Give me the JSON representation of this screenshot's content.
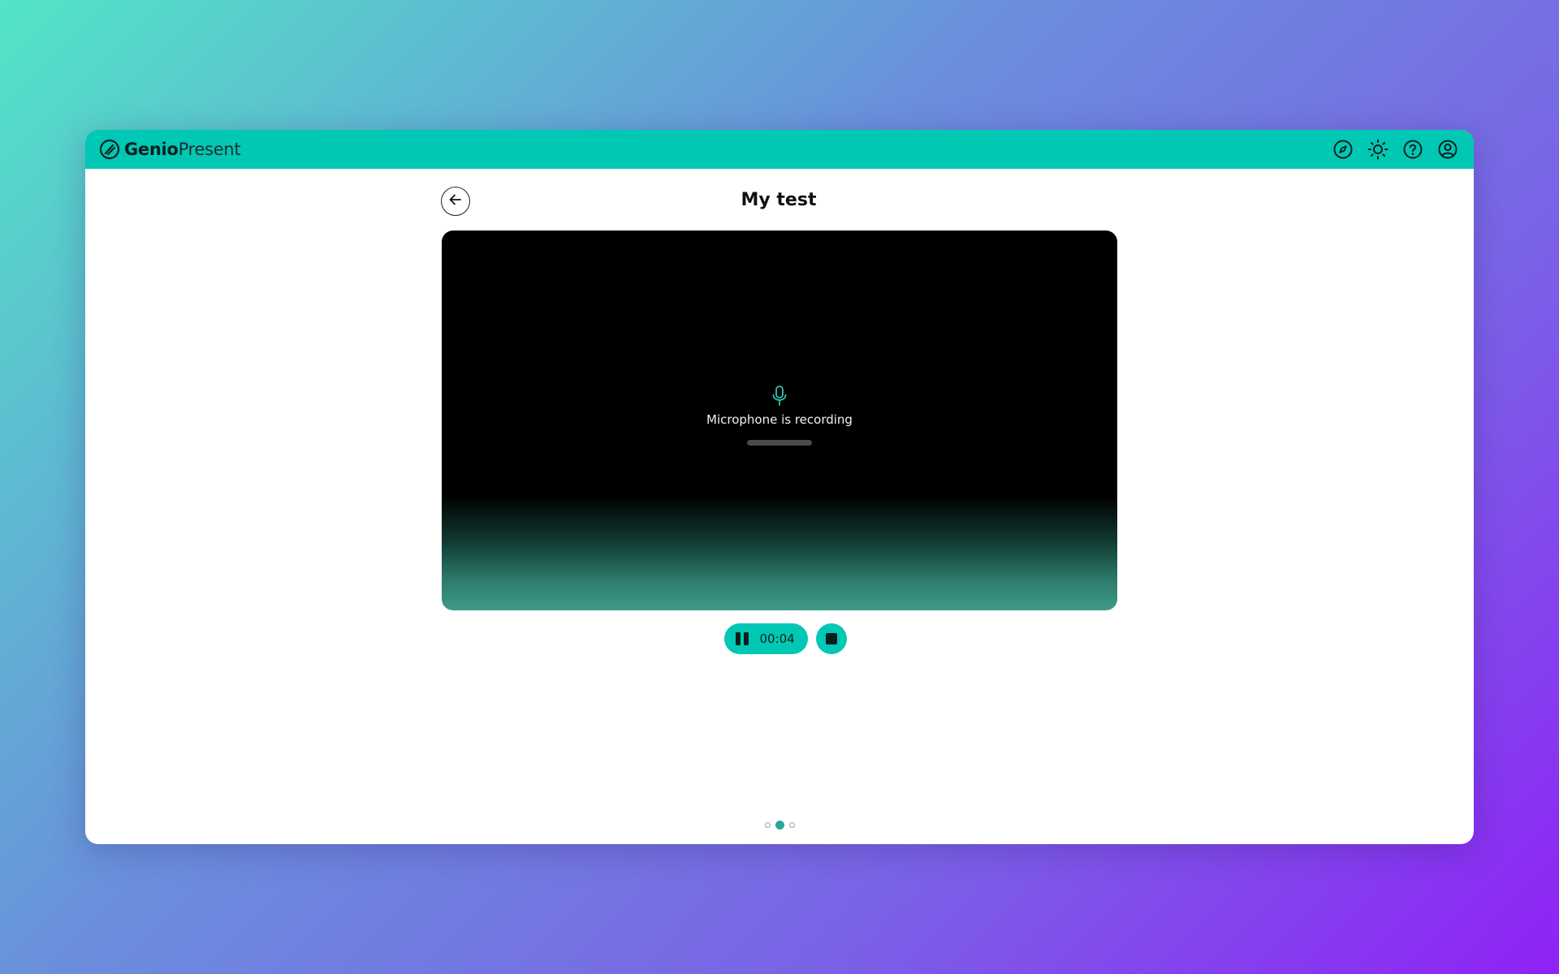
{
  "brand": {
    "name_bold": "Genio",
    "name_light": "Present"
  },
  "topbar": {
    "icons": [
      "compass-icon",
      "sun-icon",
      "help-icon",
      "account-icon"
    ]
  },
  "page": {
    "title": "My test"
  },
  "recording": {
    "icon": "microphone-icon",
    "status_text": "Microphone is recording"
  },
  "controls": {
    "timer": "00:04",
    "pause_icon": "pause-icon",
    "stop_icon": "stop-icon"
  },
  "pagination": {
    "total": 3,
    "active_index": 1
  },
  "colors": {
    "accent": "#00c8b4",
    "stage_background": "#000000",
    "stage_gradient_bottom": "#3f9b89"
  }
}
